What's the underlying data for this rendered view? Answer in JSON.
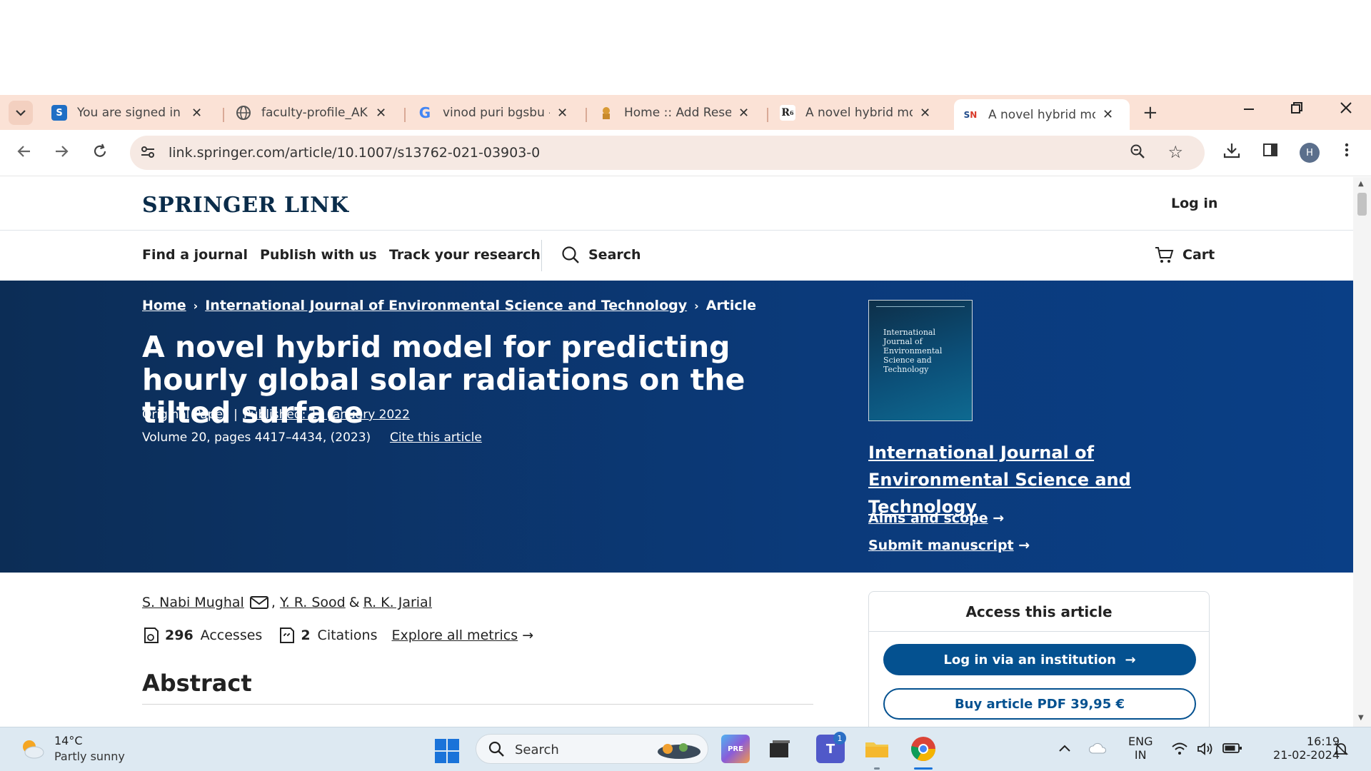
{
  "browser": {
    "tabs": [
      {
        "label": "You are signed in a",
        "favicon": "S"
      },
      {
        "label": "faculty-profile_AKL",
        "favicon": "globe"
      },
      {
        "label": "vinod puri bgsbu -",
        "favicon": "G"
      },
      {
        "label": "Home :: Add Resea",
        "favicon": "emblem"
      },
      {
        "label": "A novel hybrid mo",
        "favicon": "R6"
      },
      {
        "label": "A novel hybrid mo",
        "favicon": "SN"
      }
    ],
    "url": "link.springer.com/article/10.1007/s13762-021-03903-0",
    "profile_initial": "H"
  },
  "site": {
    "logo": "SPRINGER LINK",
    "login": "Log in",
    "nav": {
      "find_journal": "Find a journal",
      "publish": "Publish with us",
      "track": "Track your research",
      "search": "Search",
      "cart": "Cart"
    }
  },
  "article": {
    "breadcrumb": {
      "home": "Home",
      "journal": "International Journal of Environmental Science and Technology",
      "current": "Article"
    },
    "title": "A novel hybrid model for predicting hourly global solar radiations on the tilted surface",
    "type": "Original Paper",
    "published": "Published: 11 January 2022",
    "volume": "Volume 20, pages 4417–4434, (2023)",
    "cite": "Cite this article",
    "authors": {
      "a1": "S. Nabi Mughal",
      "a2": "Y. R. Sood",
      "amp": "&",
      "a3": "R. K. Jarial"
    },
    "metrics": {
      "accesses_count": "296",
      "accesses_label": "Accesses",
      "citations_count": "2",
      "citations_label": "Citations",
      "explore": "Explore all metrics"
    },
    "abstract_heading": "Abstract"
  },
  "journal": {
    "cover_text": "International Journal of Environmental Science and Technology",
    "name": "International Journal of Environmental Science and Technology",
    "aims": "Aims and scope",
    "submit": "Submit manuscript"
  },
  "access": {
    "title": "Access this article",
    "institution": "Log in via an institution",
    "buy": "Buy article PDF 39,95 €"
  },
  "taskbar": {
    "temp": "14°C",
    "weather": "Partly sunny",
    "search": "Search",
    "teams_badge": "1",
    "lang_top": "ENG",
    "lang_bottom": "IN",
    "time": "16:19",
    "date": "21-02-2024"
  },
  "colors": {
    "springer_navy": "#0c2d56",
    "primary_button": "#045190",
    "tab_strip": "#fbe2d6"
  }
}
